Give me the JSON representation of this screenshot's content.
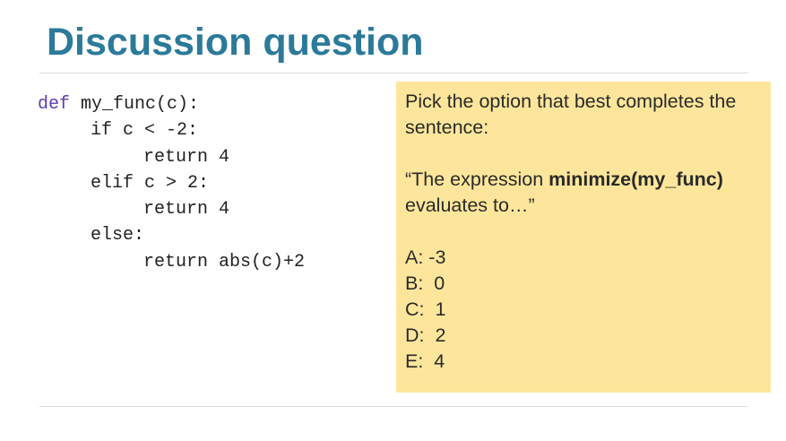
{
  "slide": {
    "title": "Discussion question"
  },
  "code": {
    "def_keyword": "def",
    "lines": [
      " my_func(c):",
      "if c < -2:",
      "return 4",
      "elif c > 2:",
      "return 4",
      "else:",
      "return abs(c)+2"
    ]
  },
  "question": {
    "prompt": "Pick the option that best completes the sentence:",
    "quote_start": "“The expression ",
    "quote_bold": "minimize(my_func)",
    "quote_end": "evaluates to…”",
    "options": [
      "A: -3",
      "B:  0",
      "C:  1",
      "D:  2",
      "E:  4"
    ]
  },
  "colors": {
    "title": "#2b7a9a",
    "card_background": "#fde69b",
    "def_keyword": "#5a3fb3"
  }
}
